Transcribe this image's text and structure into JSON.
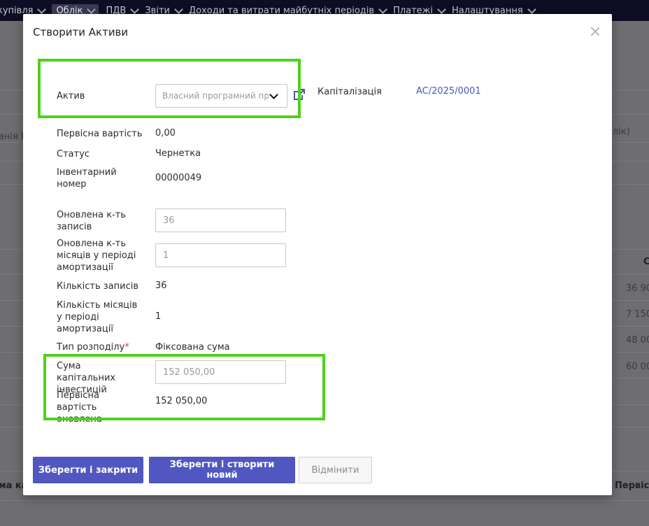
{
  "nav": {
    "items": [
      {
        "label": "купівля",
        "active": false
      },
      {
        "label": "Облік",
        "active": true
      },
      {
        "label": "ПДВ",
        "active": false
      },
      {
        "label": "Звіти",
        "active": false
      },
      {
        "label": "Доходи та витрати майбутніх періодів",
        "active": false
      },
      {
        "label": "Платежі",
        "active": false
      },
      {
        "label": "Налаштування",
        "active": false
      }
    ]
  },
  "background": {
    "left_fragment": "анія В",
    "right_fragment": "лік)",
    "col_header_right": "С",
    "amounts": [
      "36 90",
      "7 150",
      "48 00",
      "60 00"
    ],
    "footer_left": "ма ка",
    "footer_right": "Первісн"
  },
  "modal": {
    "title": "Створити Активи",
    "asset": {
      "label": "Актив",
      "value": "Власний програмний продукт"
    },
    "capitalization": {
      "label": "Капіталізація",
      "value": "AC/2025/0001"
    },
    "initial_cost": {
      "label": "Первісна вартість",
      "value": "0,00"
    },
    "status": {
      "label": "Статус",
      "value": "Чернетка"
    },
    "inventory_number": {
      "label": "Інвентарний номер",
      "value": "00000049"
    },
    "updated_records": {
      "label": "Оновлена к-ть записів",
      "placeholder": "36"
    },
    "updated_months": {
      "label": "Оновлена к-ть місяців у періоді амортизації",
      "placeholder": "1"
    },
    "records_count": {
      "label": "Кількість записів",
      "value": "36"
    },
    "months_count": {
      "label": "Кількість місяців у періоді амортизації",
      "value": "1"
    },
    "distribution_type": {
      "label": "Тип розподілу",
      "required_mark": "*",
      "value": "Фіксована сума"
    },
    "capital_investment": {
      "label": "Сума капітальних інвестицій",
      "placeholder": "152 050,00"
    },
    "initial_cost_updated": {
      "label": "Первісна вартість оновлена",
      "value": "152 050,00"
    }
  },
  "buttons": {
    "save_close": "Зберегти і закрити",
    "save_new": "Зберегти і створити новий",
    "cancel": "Відмінити"
  },
  "colors": {
    "primary": "#5157c1",
    "highlight": "#4fd11a",
    "link": "#4a55b8",
    "nav_bg": "#0d0d24"
  }
}
